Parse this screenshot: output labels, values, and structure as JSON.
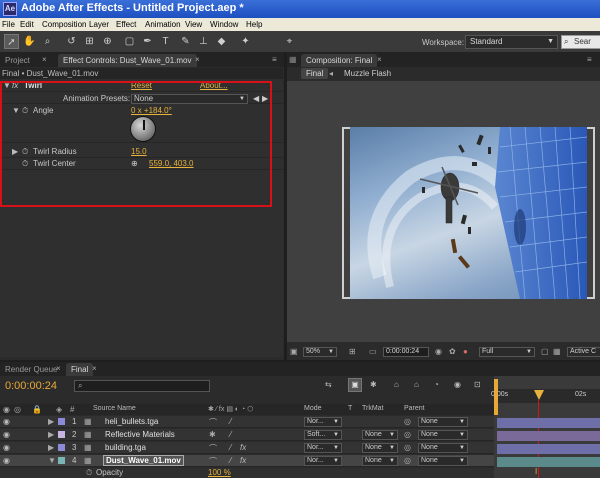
{
  "window": {
    "title": "Adobe After Effects - Untitled Project.aep *"
  },
  "menu": [
    "File",
    "Edit",
    "Composition",
    "Layer",
    "Effect",
    "Animation",
    "View",
    "Window",
    "Help"
  ],
  "toolbar": {
    "workspace_label": "Workspace:",
    "workspace_value": "Standard",
    "search_placeholder": "Sear"
  },
  "project_tab": "Project",
  "effect_controls": {
    "tab_label": "Effect Controls: Dust_Wave_01.mov",
    "header": "Final • Dust_Wave_01.mov",
    "effect_name": "Twirl",
    "reset": "Reset",
    "about": "About...",
    "presets_label": "Animation Presets:",
    "presets_value": "None",
    "angle_label": "Angle",
    "angle_value": "0 x +184.0°",
    "radius_label": "Twirl Radius",
    "radius_value": "15.0",
    "center_label": "Twirl Center",
    "center_value": "559.0, 403.0"
  },
  "composition": {
    "tab_label": "Composition: Final",
    "breadcrumbs": [
      "Final",
      "Muzzle Flash"
    ],
    "zoom": "50%",
    "timecode": "0:00:00:24",
    "resolution": "Full",
    "camera": "Active C"
  },
  "timeline": {
    "tabs": [
      "Render Queue",
      "Final"
    ],
    "current_time": "0:00:00:24",
    "columns": {
      "source_name": "Source Name",
      "mode": "Mode",
      "t": "T",
      "trkmat": "TrkMat",
      "parent": "Parent"
    },
    "layers": [
      {
        "num": "1",
        "name": "heli_bullets.tga",
        "mode": "Nor...",
        "trkmat": "",
        "parent": "None",
        "color": "#8a8ad8",
        "bar_color": "#6e6ea8"
      },
      {
        "num": "2",
        "name": "Reflective Materials",
        "mode": "Soft...",
        "trkmat": "None",
        "parent": "None",
        "color": "#c8b4e0",
        "bar_color": "#7a6a9a"
      },
      {
        "num": "3",
        "name": "building.tga",
        "mode": "Nor...",
        "trkmat": "None",
        "parent": "None",
        "color": "#8a8ad8",
        "bar_color": "#6e6ea8"
      },
      {
        "num": "4",
        "name": "Dust_Wave_01.mov",
        "mode": "Nor...",
        "trkmat": "None",
        "parent": "None",
        "color": "#7ab4b4",
        "bar_color": "#5a8a8a"
      }
    ],
    "opacity_label": "Opacity",
    "opacity_value": "100 %",
    "ruler": [
      "0:00s",
      "02s"
    ]
  }
}
